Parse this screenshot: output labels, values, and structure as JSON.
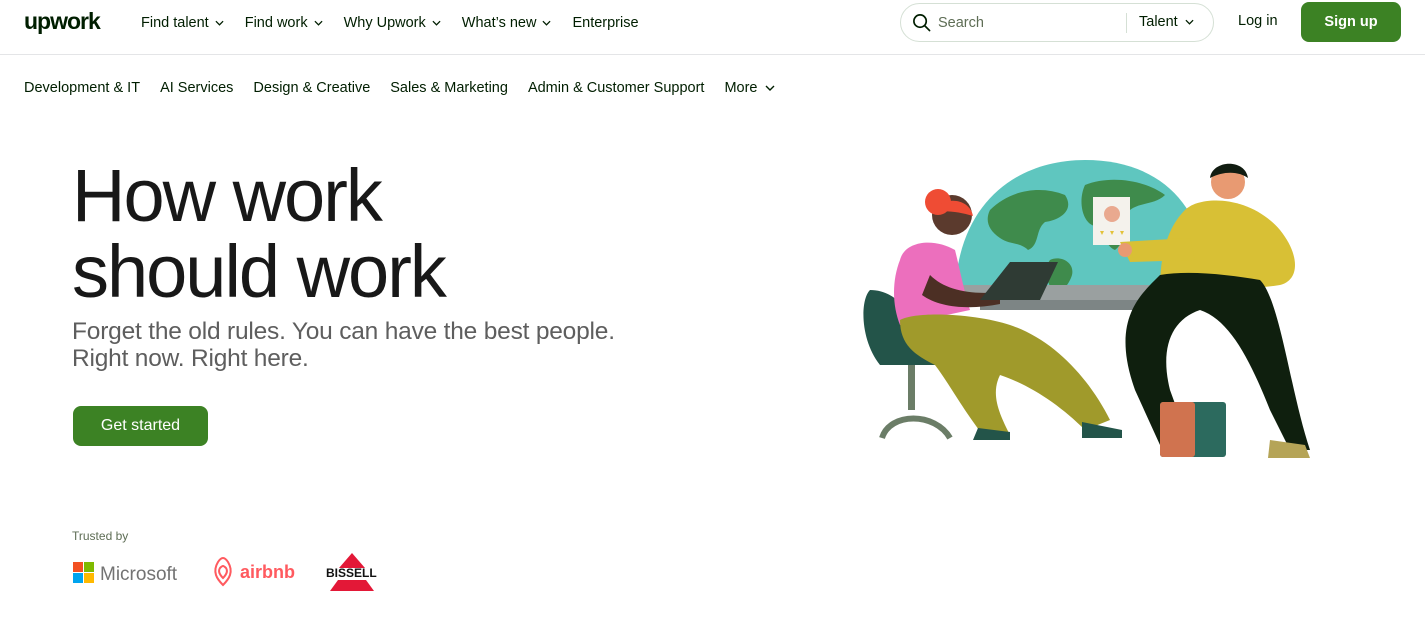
{
  "header": {
    "logo_text": "upwork",
    "nav": [
      {
        "label": "Find talent",
        "has_dropdown": true
      },
      {
        "label": "Find work",
        "has_dropdown": true
      },
      {
        "label": "Why Upwork",
        "has_dropdown": true
      },
      {
        "label": "What’s new",
        "has_dropdown": true
      },
      {
        "label": "Enterprise",
        "has_dropdown": false
      }
    ],
    "search": {
      "placeholder": "Search",
      "scope": "Talent"
    },
    "login_label": "Log in",
    "signup_label": "Sign up"
  },
  "categories": [
    {
      "label": "Development & IT"
    },
    {
      "label": "AI Services"
    },
    {
      "label": "Design & Creative"
    },
    {
      "label": "Sales & Marketing"
    },
    {
      "label": "Admin & Customer Support"
    },
    {
      "label": "More",
      "has_dropdown": true
    }
  ],
  "hero": {
    "title_line1": "How work",
    "title_line2": "should work",
    "subtitle_line1": "Forget the old rules. You can have the best people.",
    "subtitle_line2": "Right now. Right here.",
    "cta_label": "Get started"
  },
  "trusted": {
    "label": "Trusted by",
    "logos": [
      "Microsoft",
      "airbnb",
      "BISSELL"
    ]
  },
  "colors": {
    "brand_green": "#3c8224",
    "text_dark": "#001e00",
    "airbnb_red": "#ff5a5f",
    "bissell_red": "#e31837"
  },
  "icons": [
    "search-icon",
    "chevron-down-icon"
  ]
}
